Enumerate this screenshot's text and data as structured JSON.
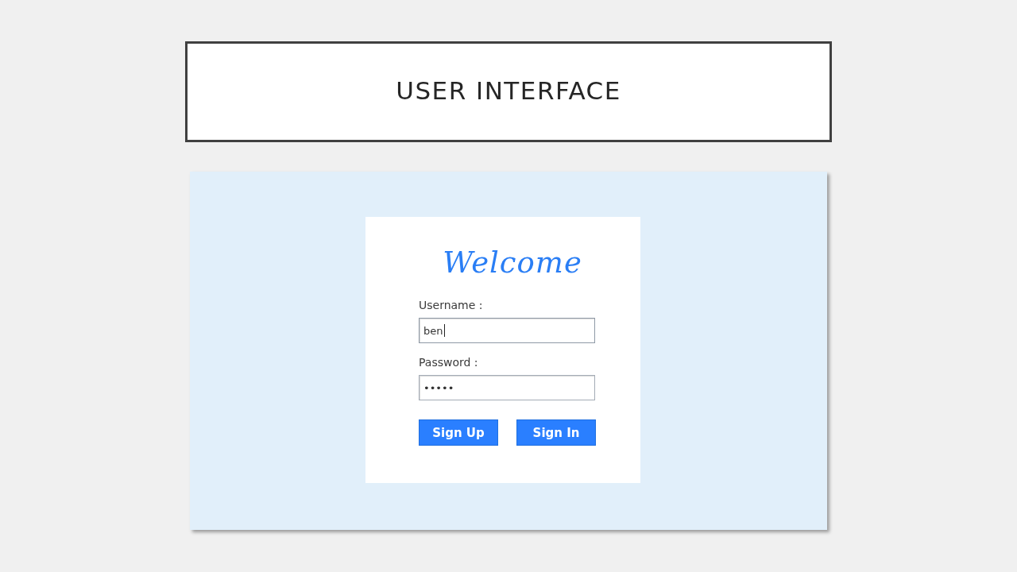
{
  "slide": {
    "title": "USER INTERFACE"
  },
  "login_screen": {
    "heading": "Welcome",
    "fields": [
      {
        "label": "Username :",
        "value": "ben",
        "focused": true
      },
      {
        "label": "Password :",
        "value": "•••••",
        "focused": false
      }
    ],
    "buttons": [
      "Sign Up",
      "Sign In"
    ]
  }
}
